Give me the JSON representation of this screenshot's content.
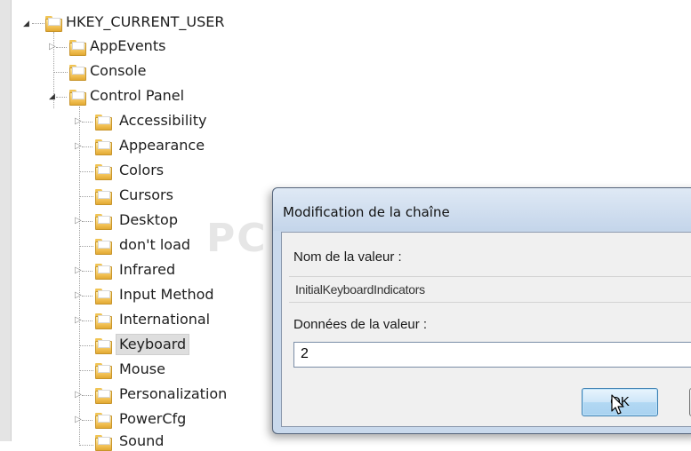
{
  "tree": {
    "root": "HKEY_CURRENT_USER",
    "items": [
      {
        "label": "AppEvents"
      },
      {
        "label": "Console"
      },
      {
        "label": "Control Panel"
      },
      {
        "label": "Accessibility"
      },
      {
        "label": "Appearance"
      },
      {
        "label": "Colors"
      },
      {
        "label": "Cursors"
      },
      {
        "label": "Desktop"
      },
      {
        "label": "don't load"
      },
      {
        "label": "Infrared"
      },
      {
        "label": "Input Method"
      },
      {
        "label": "International"
      },
      {
        "label": "Keyboard"
      },
      {
        "label": "Mouse"
      },
      {
        "label": "Personalization"
      },
      {
        "label": "PowerCfg"
      },
      {
        "label": "Sound"
      }
    ],
    "selected": "Keyboard"
  },
  "watermark": "PC ASTUCES",
  "dialog": {
    "title": "Modification de la chaîne",
    "name_label": "Nom de la valeur :",
    "name_value": "InitialKeyboardIndicators",
    "data_label": "Données de la valeur :",
    "data_value": "2",
    "ok_label": "OK"
  },
  "colors": {
    "selection": "#dedede",
    "button_border": "#3c7fb1",
    "dialog_frame": "#c9d9ec"
  }
}
